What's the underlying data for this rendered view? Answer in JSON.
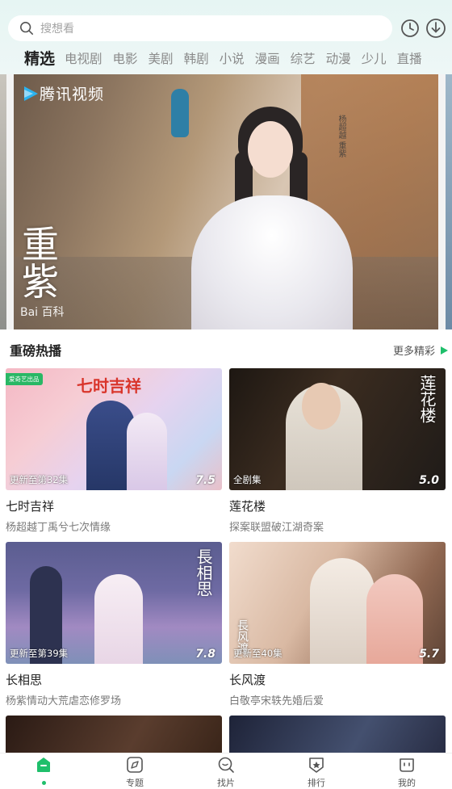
{
  "header": {
    "search_placeholder": "搜想看",
    "icons": {
      "search": "search-icon",
      "history": "clock-icon",
      "download": "download-icon"
    }
  },
  "tabs": [
    {
      "label": "精选",
      "active": true
    },
    {
      "label": "电视剧"
    },
    {
      "label": "电影"
    },
    {
      "label": "美剧"
    },
    {
      "label": "韩剧"
    },
    {
      "label": "小说"
    },
    {
      "label": "漫画"
    },
    {
      "label": "综艺"
    },
    {
      "label": "动漫"
    },
    {
      "label": "少儿"
    },
    {
      "label": "直播"
    }
  ],
  "banner": {
    "brand": "腾讯视频",
    "calligraphy": "重紫",
    "baike": "Bai 百科",
    "sign": "杨超越 重紫"
  },
  "section": {
    "title": "重磅热播",
    "more": "更多精彩"
  },
  "cards": [
    {
      "name": "七时吉祥",
      "desc": "杨超越丁禹兮七次情缘",
      "update": "更新至第32集",
      "score": "7.5",
      "tag": "爱奇艺出品",
      "overlay_title": "七时吉祥"
    },
    {
      "name": "莲花楼",
      "desc": "探案联盟破江湖奇案",
      "update": "全剧集",
      "score": "5.0",
      "overlay_title": "莲花楼"
    },
    {
      "name": "长相思",
      "desc": "杨紫情动大荒虐恋修罗场",
      "update": "更新至第39集",
      "score": "7.8",
      "overlay_title": "長相思"
    },
    {
      "name": "长风渡",
      "desc": "白敬亭宋轶先婚后爱",
      "update": "更新至40集",
      "score": "5.7",
      "overlay_title": "長风渡"
    }
  ],
  "nav": [
    {
      "label": "",
      "icon": "home-icon",
      "active": true
    },
    {
      "label": "专题",
      "icon": "compass-icon"
    },
    {
      "label": "找片",
      "icon": "search-icon"
    },
    {
      "label": "排行",
      "icon": "badge-icon"
    },
    {
      "label": "我的",
      "icon": "profile-icon"
    }
  ],
  "colors": {
    "accent": "#1fbf6b",
    "header_bg": "#e6f5f3"
  }
}
